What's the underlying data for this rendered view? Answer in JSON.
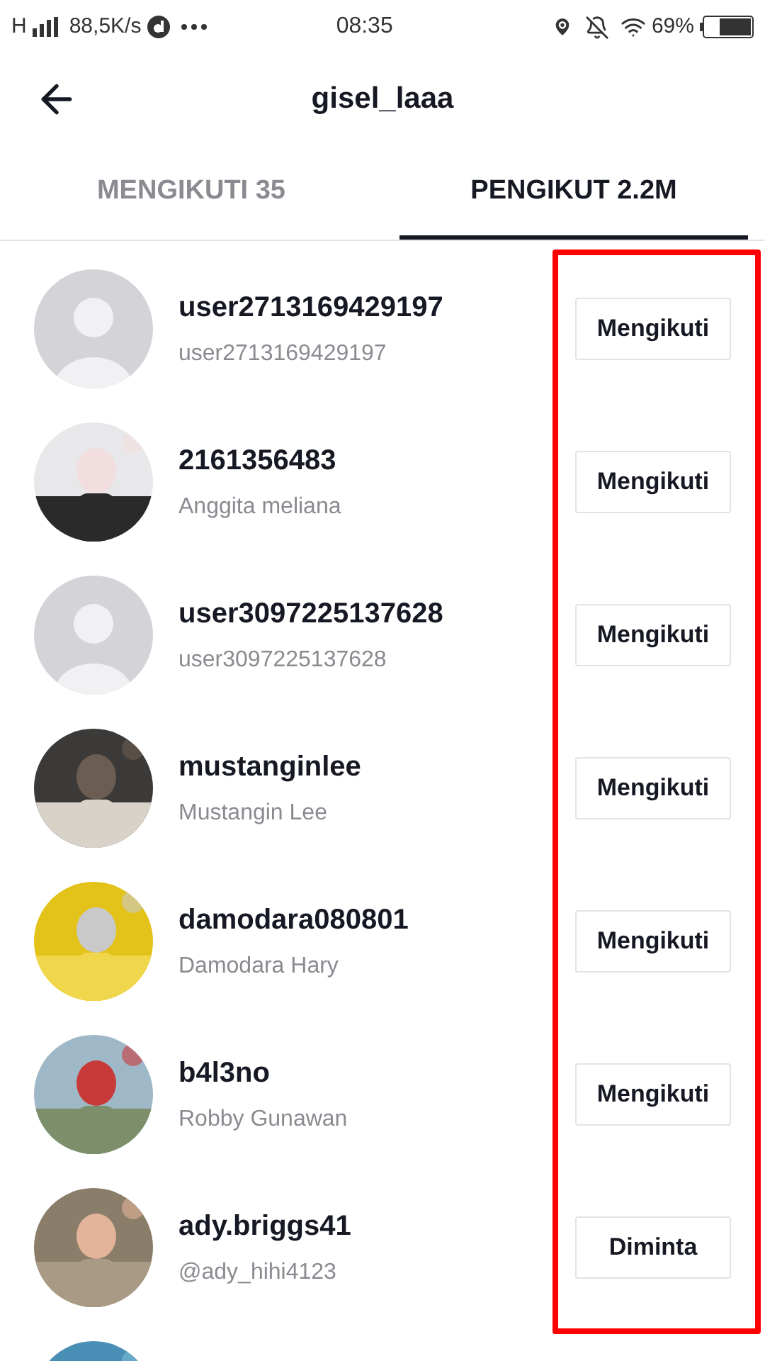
{
  "status_bar": {
    "network": "H",
    "speed": "88,5K/s",
    "time": "08:35",
    "battery": "69%"
  },
  "header": {
    "title": "gisel_laaa"
  },
  "tabs": [
    {
      "label": "MENGIKUTI 35",
      "selected": false
    },
    {
      "label": "PENGIKUT 2.2M",
      "selected": true
    }
  ],
  "followers": [
    {
      "avatar": {
        "kind": "default"
      },
      "username": "user2713169429197",
      "name": "user2713169429197",
      "button": "Mengikuti"
    },
    {
      "avatar": {
        "kind": "picture"
      },
      "username": "2161356483",
      "name": "Anggita meliana",
      "button": "Mengikuti"
    },
    {
      "avatar": {
        "kind": "default"
      },
      "username": "user3097225137628",
      "name": "user3097225137628",
      "button": "Mengikuti"
    },
    {
      "avatar": {
        "kind": "picture"
      },
      "username": "mustanginlee",
      "name": "Mustangin Lee",
      "button": "Mengikuti"
    },
    {
      "avatar": {
        "kind": "picture"
      },
      "username": "damodara080801",
      "name": "Damodara Hary",
      "button": "Mengikuti"
    },
    {
      "avatar": {
        "kind": "picture"
      },
      "username": "b4l3no",
      "name": "Robby Gunawan",
      "button": "Mengikuti"
    },
    {
      "avatar": {
        "kind": "picture"
      },
      "username": "ady.briggs41",
      "name": "@ady_hihi4123",
      "button": "Diminta"
    },
    {
      "avatar": {
        "kind": "picture"
      }
    }
  ]
}
